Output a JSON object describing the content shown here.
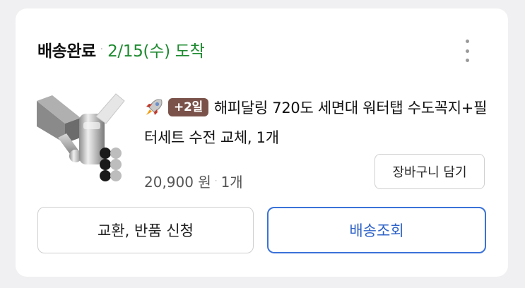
{
  "order": {
    "status": "배송완료",
    "arrival": "2/15(수) 도착",
    "separator": "·",
    "more_icon": "more-vertical-icon"
  },
  "product": {
    "badge_icon": "rocket-icon",
    "badge": "+2일",
    "title": "해피달링 720도 세면대 워터탭 수도꼭지+필터세트 수전 교체, 1개",
    "price": "20,900 원",
    "quantity": "1개",
    "image_icon": "faucet-product-image"
  },
  "buttons": {
    "add_to_cart": "장바구니 담기",
    "return_exchange": "교환, 반품 신청",
    "track_delivery": "배송조회"
  },
  "colors": {
    "arrival": "#1e8a30",
    "badge_bg": "#7a5249",
    "track_accent": "#3a72d8"
  }
}
